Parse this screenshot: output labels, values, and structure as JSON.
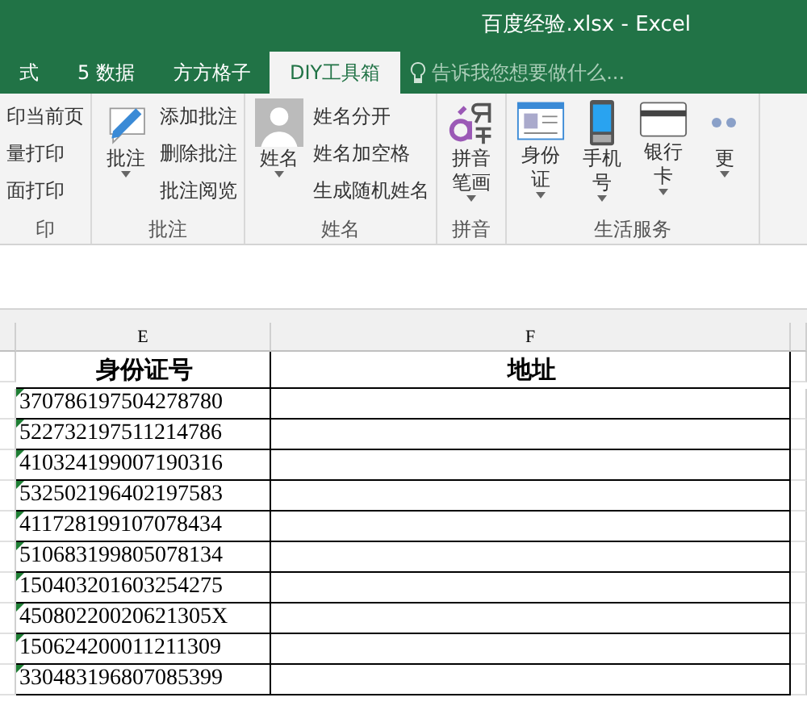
{
  "window": {
    "title": "百度经验.xlsx - Excel"
  },
  "tabs": [
    {
      "label": "式",
      "selected": false
    },
    {
      "label": "5 数据",
      "selected": false
    },
    {
      "label": "方方格子",
      "selected": false
    },
    {
      "label": "DIY工具箱",
      "selected": true
    }
  ],
  "tell_me": {
    "placeholder": "告诉我您想要做什么..."
  },
  "ribbon": {
    "groups": [
      {
        "label": "印",
        "small": [
          "印当前页",
          "量打印",
          "面打印"
        ]
      },
      {
        "label": "批注",
        "large": [
          {
            "label": "批注",
            "kind": "pencil",
            "dropdown": true
          }
        ],
        "small": [
          "添加批注",
          "删除批注",
          "批注阅览"
        ]
      },
      {
        "label": "姓名",
        "large": [
          {
            "label": "姓名",
            "kind": "person",
            "dropdown": true
          }
        ],
        "small": [
          "姓名分开",
          "姓名加空格",
          "生成随机姓名"
        ]
      },
      {
        "label": "拼音",
        "large": [
          {
            "label": "拼音笔画",
            "kind": "pinyin",
            "dropdown": true
          }
        ]
      },
      {
        "label": "生活服务",
        "large": [
          {
            "label": "身份证",
            "kind": "idcard",
            "dropdown": true
          },
          {
            "label": "手机号",
            "kind": "phone",
            "dropdown": true
          },
          {
            "label": "银行卡",
            "kind": "bankcard",
            "dropdown": true
          },
          {
            "label": "更",
            "kind": "more",
            "dropdown": true
          }
        ]
      }
    ]
  },
  "sheet": {
    "columns": [
      "E",
      "F"
    ],
    "header": [
      "身份证号",
      "地址"
    ],
    "rows": [
      "370786197504278780",
      "522732197511214786",
      "410324199007190316",
      "532502196402197583",
      "411728199107078434",
      "510683199805078134",
      "150403201603254275",
      "45080220020621305X",
      "150624200011211309",
      "330483196807085399"
    ]
  }
}
